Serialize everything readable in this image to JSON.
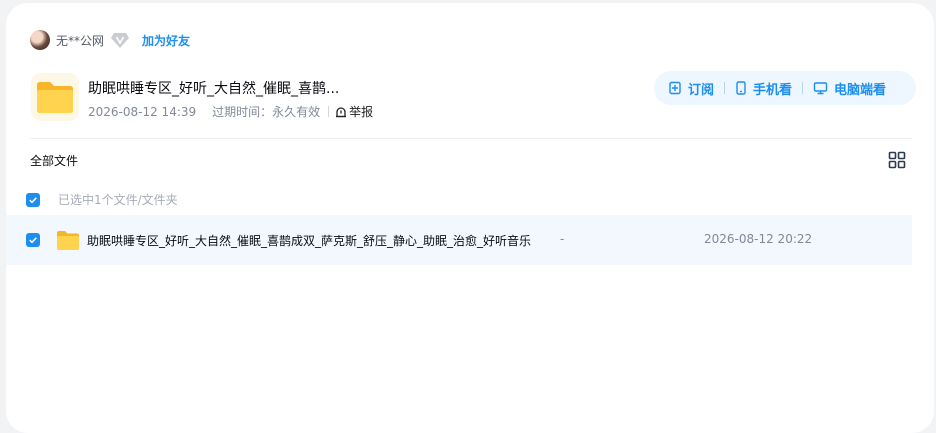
{
  "user": {
    "name": "无**公网",
    "add_friend": "加为好友"
  },
  "share": {
    "title": "助眠哄睡专区_好听_大自然_催眠_喜鹊...",
    "created": "2026-08-12 14:39",
    "expire_label": "过期时间：",
    "expire_value": "永久有效",
    "report": "举报"
  },
  "actions": {
    "subscribe": "订阅",
    "mobile": "手机看",
    "desktop": "电脑端看"
  },
  "browser": {
    "breadcrumb": "全部文件",
    "selected_text": "已选中1个文件/文件夹"
  },
  "files": [
    {
      "name": "助眠哄睡专区_好听_大自然_催眠_喜鹊成双_萨克斯_舒压_静心_助眠_治愈_好听音乐",
      "size": "-",
      "date": "2026-08-12 20:22",
      "checked": true
    }
  ],
  "colors": {
    "accent": "#1b8ef0",
    "folder": "#ffc83d",
    "row_highlight": "#f2f8fe"
  }
}
